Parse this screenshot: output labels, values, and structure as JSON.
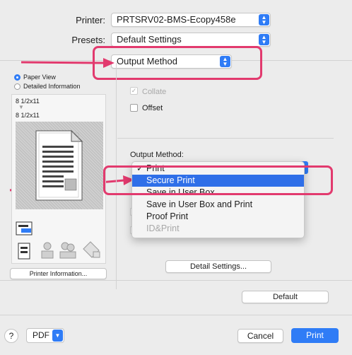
{
  "printer": {
    "label": "Printer:",
    "value": "PRTSRV02-BMS-Ecopy458e"
  },
  "presets": {
    "label": "Presets:",
    "value": "Default Settings"
  },
  "section_popup": {
    "value": "Output Method"
  },
  "left_panel": {
    "view_options": [
      "Paper View",
      "Detailed Information"
    ],
    "paper_size_top": "8 1/2x11",
    "paper_size_bottom": "8 1/2x11",
    "printer_info_button": "Printer Information..."
  },
  "options": {
    "collate_label": "Collate",
    "offset_label": "Offset",
    "output_method_label": "Output Method:"
  },
  "output_menu": {
    "items": [
      {
        "label": "Print",
        "checked": true,
        "selected": false,
        "disabled": false
      },
      {
        "label": "Secure Print",
        "checked": false,
        "selected": true,
        "disabled": false
      },
      {
        "label": "Save in User Box",
        "checked": false,
        "selected": false,
        "disabled": false
      },
      {
        "label": "Save in User Box and Print",
        "checked": false,
        "selected": false,
        "disabled": false
      },
      {
        "label": "Proof Print",
        "checked": false,
        "selected": false,
        "disabled": false
      },
      {
        "label": "ID&Print",
        "checked": false,
        "selected": false,
        "disabled": true
      }
    ],
    "check_mark": "✓"
  },
  "buttons": {
    "detail_settings": "Detail Settings...",
    "default": "Default",
    "help": "?",
    "pdf": "PDF",
    "cancel": "Cancel",
    "print": "Print"
  },
  "colors": {
    "accent": "#2f7cf6",
    "annotation": "#e23a6e"
  }
}
